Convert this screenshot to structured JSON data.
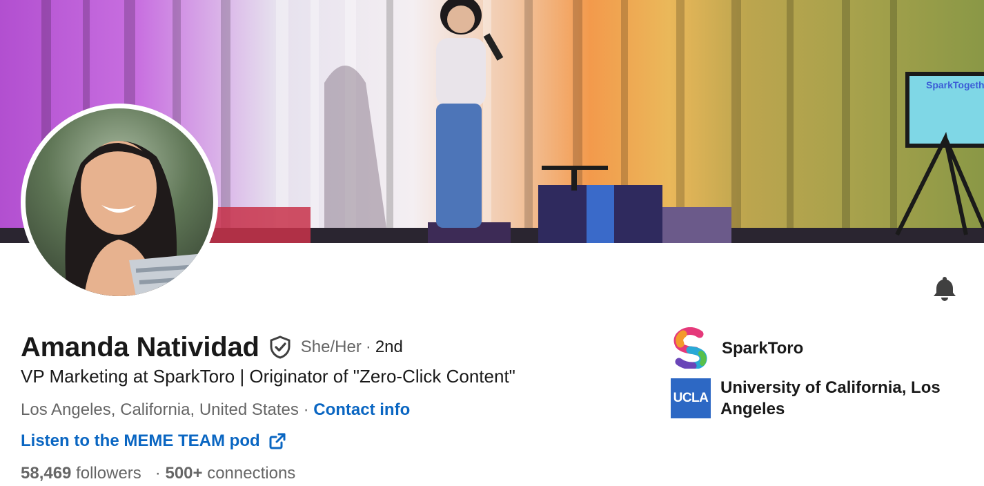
{
  "profile": {
    "name": "Amanda Natividad",
    "pronouns": "She/Her",
    "separator": "·",
    "degree": "2nd",
    "headline": "VP Marketing at SparkToro | Originator of \"Zero-Click Content\"",
    "location": "Los Angeles, California, United States",
    "contact_label": "Contact info",
    "link_label": "Listen to the MEME TEAM pod",
    "followers_count": "58,469",
    "followers_label": "followers",
    "connections_count": "500+",
    "connections_label": "connections"
  },
  "cover": {
    "stage_screen_text": "SparkTogether"
  },
  "orgs": [
    {
      "name": "SparkToro",
      "logo": "sparktoro-logo"
    },
    {
      "name_line1": "University of California, Los",
      "name_line2": "Angeles",
      "logo_text": "UCLA"
    }
  ],
  "icons": {
    "verified": "shield-check-icon",
    "notifications": "bell-icon",
    "external_link": "external-link-icon"
  },
  "colors": {
    "link": "#0a66c2",
    "text_primary": "#191919",
    "text_secondary": "#666666",
    "ucla_blue": "#2d68c4"
  }
}
